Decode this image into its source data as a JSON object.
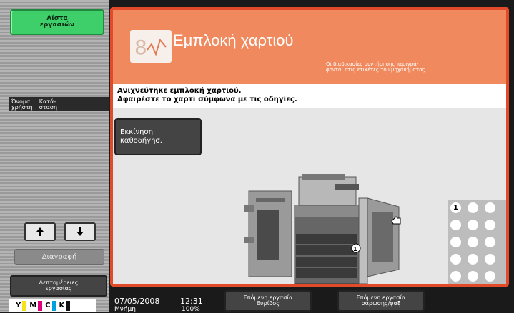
{
  "sidebar": {
    "job_list_label": "Λίστα\nεργασιών",
    "col_user": "Όνομα\nχρήστη",
    "col_status": "Κατά-\nσταση",
    "delete_label": "Διαγραφή",
    "details_label": "Λεπτομέρειες\nεργασίας",
    "toner": [
      {
        "letter": "Y",
        "color": "#f5e21a"
      },
      {
        "letter": "M",
        "color": "#e0007a"
      },
      {
        "letter": "C",
        "color": "#00a0e0"
      },
      {
        "letter": "K",
        "color": "#111111"
      }
    ]
  },
  "header": {
    "title": "Εμπλοκή χαρτιού",
    "note": "Οι διαδικασίες συντήρησης περιγρά-\nφονται στις ετικέτες του μηχανήματος."
  },
  "message": {
    "line1": "Ανιχνεύτηκε εμπλοκή χαρτιού.",
    "line2": "Αφαιρέστε το χαρτί σύμφωνα με τις οδηγίες."
  },
  "guide_button": "Εκκίνηση\nκαθοδήγησ.",
  "illustration": {
    "marker_device": "1",
    "marker_grid": "1"
  },
  "status_bar": {
    "date": "07/05/2008",
    "time": "12:31",
    "memory_label": "Μνήμη",
    "memory_value": "100%",
    "next_job_door": "Επόμενη εργασία\nθυρίδος",
    "next_job_scan": "Επόμενη εργασία\nσάρωσης/φαξ"
  },
  "colors": {
    "accent": "#e24a2a",
    "banner": "#f08a5e",
    "green": "#3fcf6a"
  }
}
